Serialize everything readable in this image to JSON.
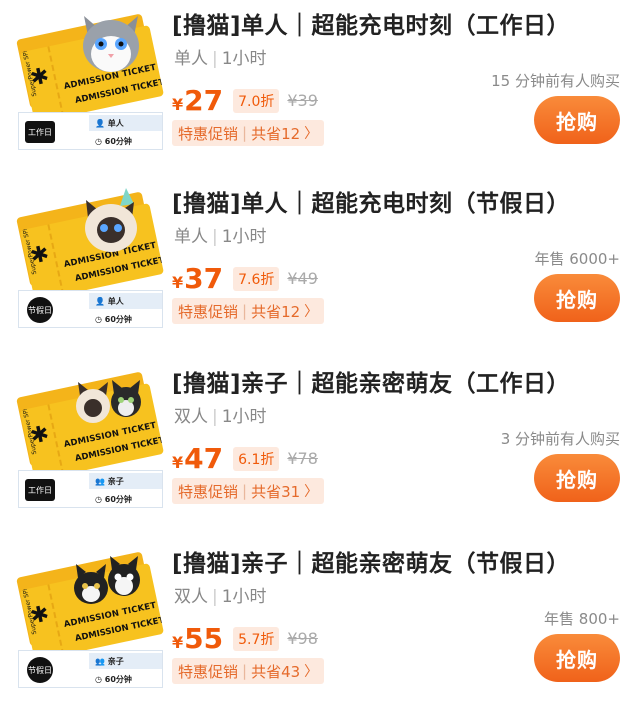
{
  "products": [
    {
      "title": "[撸猫]单人｜超能充电时刻（工作日）",
      "people": "单人",
      "duration": "1小时",
      "social_proof": "15 分钟前有人购买",
      "currency": "¥",
      "price": "27",
      "discount": "7.0折",
      "original_price": "¥39",
      "promo_label": "特惠促销",
      "promo_saving": "共省12",
      "buy_label": "抢购",
      "ticket_brand": "SuperPower SPECKS",
      "ticket_text": "ADMISSION TICKET",
      "ticket_day": "工作日",
      "ticket_type": "单人",
      "ticket_duration": "60分钟",
      "icon": "cat-blue-eyes-icon"
    },
    {
      "title": "[撸猫]单人｜超能充电时刻（节假日）",
      "people": "单人",
      "duration": "1小时",
      "social_proof": "年售 6000+",
      "currency": "¥",
      "price": "37",
      "discount": "7.6折",
      "original_price": "¥49",
      "promo_label": "特惠促销",
      "promo_saving": "共省12",
      "buy_label": "抢购",
      "ticket_brand": "SuperPower SPECKS",
      "ticket_text": "ADMISSION TICKET",
      "ticket_day": "节假日",
      "ticket_type": "单人",
      "ticket_duration": "60分钟",
      "icon": "cat-party-hat-icon"
    },
    {
      "title": "[撸猫]亲子｜超能亲密萌友（工作日）",
      "people": "双人",
      "duration": "1小时",
      "social_proof": "3 分钟前有人购买",
      "currency": "¥",
      "price": "47",
      "discount": "6.1折",
      "original_price": "¥78",
      "promo_label": "特惠促销",
      "promo_saving": "共省31",
      "buy_label": "抢购",
      "ticket_brand": "SuperPower SPECKS",
      "ticket_text": "ADMISSION TICKET",
      "ticket_day": "工作日",
      "ticket_type": "亲子",
      "ticket_duration": "60分钟",
      "icon": "two-cats-icon"
    },
    {
      "title": "[撸猫]亲子｜超能亲密萌友（节假日）",
      "people": "双人",
      "duration": "1小时",
      "social_proof": "年售 800+",
      "currency": "¥",
      "price": "55",
      "discount": "5.7折",
      "original_price": "¥98",
      "promo_label": "特惠促销",
      "promo_saving": "共省43",
      "buy_label": "抢购",
      "ticket_brand": "SuperPower SPECKS",
      "ticket_text": "ADMISSION TICKET",
      "ticket_day": "节假日",
      "ticket_type": "亲子",
      "ticket_duration": "60分钟",
      "icon": "two-tuxedo-cats-icon"
    }
  ],
  "colors": {
    "accent": "#f05a0a",
    "promo_bg": "#fde9de",
    "ticket": "#f7c21f"
  }
}
